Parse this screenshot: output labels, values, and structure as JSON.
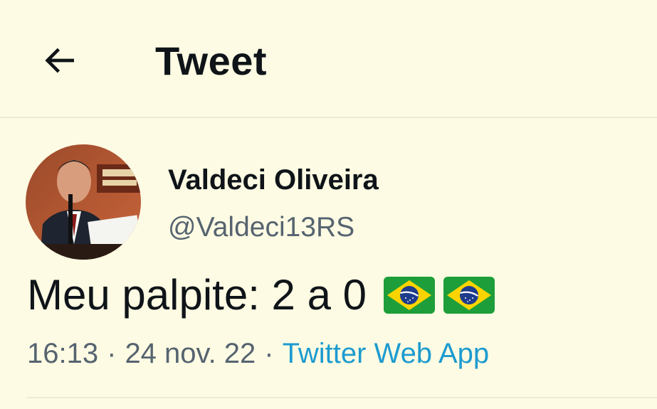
{
  "header": {
    "title": "Tweet",
    "back_icon": "arrow-left-icon"
  },
  "author": {
    "display_name": "Valdeci Oliveira",
    "handle": "@Valdeci13RS",
    "avatar_icon": "avatar-photo"
  },
  "tweet": {
    "text": "Meu palpite: 2 a 0",
    "emojis": [
      "brazil-flag-icon",
      "brazil-flag-icon"
    ],
    "time": "16:13",
    "date": "24 nov. 22",
    "separator": "·",
    "source": "Twitter Web App"
  },
  "colors": {
    "background": "#fdfbe3",
    "text": "#0f1419",
    "secondary_text": "#566370",
    "link": "#1d9bd0",
    "divider": "#eeecd6"
  }
}
